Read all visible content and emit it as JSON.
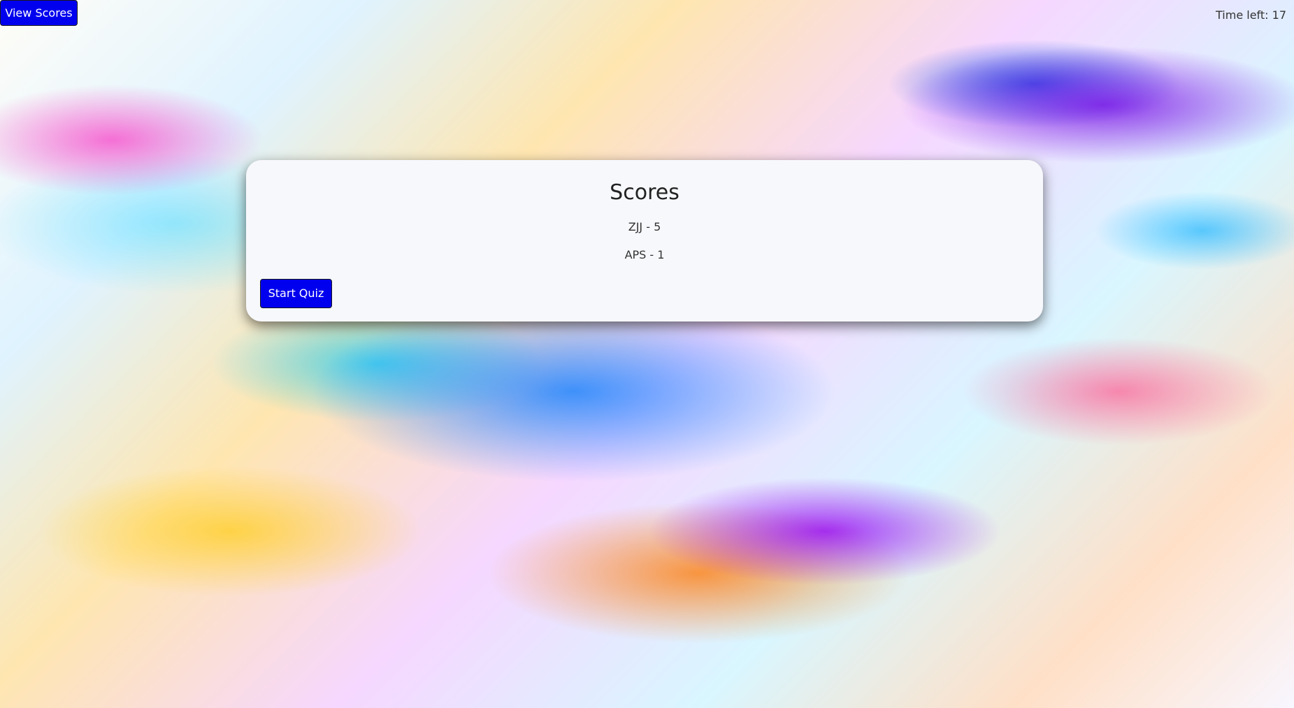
{
  "top_bar": {
    "view_scores_label": "View Scores",
    "timer_text": "Time left: 17"
  },
  "scores_panel": {
    "title": "Scores",
    "entries": [
      {
        "text": "ZJJ - 5"
      },
      {
        "text": "APS - 1"
      }
    ],
    "start_button_label": "Start Quiz"
  },
  "colors": {
    "button_bg": "#0000ee",
    "button_text": "#ffffff",
    "card_bg": "#f7f8fc"
  }
}
